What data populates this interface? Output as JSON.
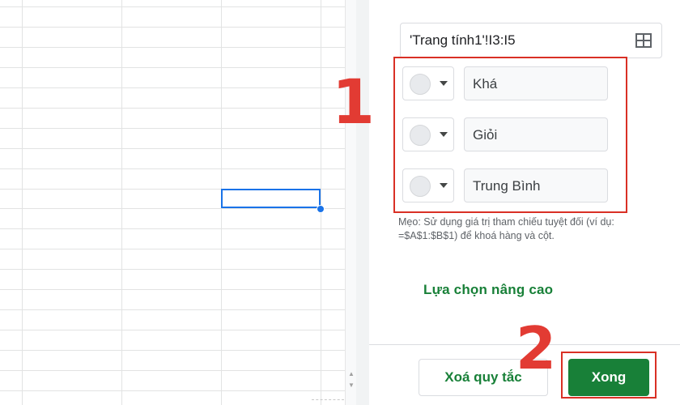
{
  "sheet": {
    "selected_cell_color": "#1a73e8"
  },
  "panel": {
    "range": {
      "value": "'Trang tính1'!I3:I5",
      "icon": "select-range-grid-icon"
    },
    "rules": [
      {
        "color_icon": "color-swatch-icon",
        "value": "Khá"
      },
      {
        "color_icon": "color-swatch-icon",
        "value": "Giỏi"
      },
      {
        "color_icon": "color-swatch-icon",
        "value": "Trung Bình"
      }
    ],
    "hint_line1": "Mẹo: Sử dụng giá trị tham chiếu tuyệt đối (ví dụ:",
    "hint_line2": "=$A$1:$B$1) để khoá hàng và cột.",
    "advanced_label": "Lựa chọn nâng cao",
    "clear_label": "Xoá quy tắc",
    "done_label": "Xong"
  },
  "annotations": {
    "one": "1",
    "two": "2",
    "highlight_color": "#d93025"
  },
  "colors": {
    "accent_green": "#188038",
    "border_gray": "#dadce0"
  }
}
